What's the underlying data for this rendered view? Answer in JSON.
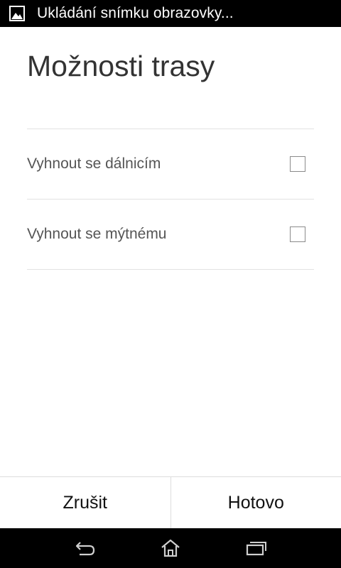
{
  "status_bar": {
    "notification_icon": "image-icon",
    "notification_text": "Ukládání snímku obrazovky..."
  },
  "dialog": {
    "title": "Možnosti trasy",
    "options": [
      {
        "label": "Vyhnout se dálnicím",
        "checked": false
      },
      {
        "label": "Vyhnout se mýtnému",
        "checked": false
      }
    ],
    "buttons": {
      "cancel": "Zrušit",
      "done": "Hotovo"
    }
  },
  "nav_bar": {
    "back_icon": "back-icon",
    "home_icon": "home-icon",
    "recents_icon": "recents-icon"
  },
  "colors": {
    "status_bar_bg": "#000000",
    "background": "#ffffff",
    "divider": "#e2e2e2",
    "title_text": "#333333",
    "option_text": "#555555"
  }
}
